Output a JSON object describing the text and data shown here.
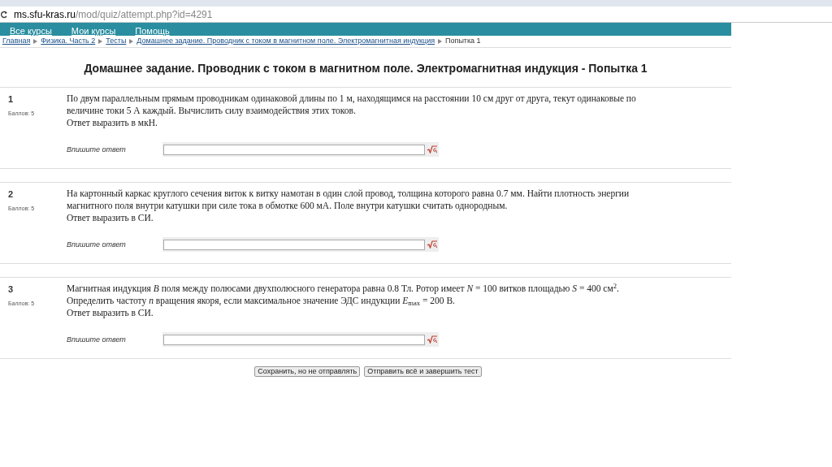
{
  "browser": {
    "url_host": "ms.sfu-kras.ru",
    "url_path": "/mod/quiz/attempt.php?id=4291"
  },
  "nav": [
    "Все курсы",
    "Мои курсы",
    "Помощь"
  ],
  "breadcrumb": [
    {
      "label": "Главная",
      "link": true
    },
    {
      "label": "Физика. Часть 2",
      "link": true
    },
    {
      "label": "Тесты",
      "link": true
    },
    {
      "label": "Домашнее задание. Проводник с током в магнитном поле. Электромагнитная индукция",
      "link": true
    },
    {
      "label": "Попытка 1",
      "link": false
    }
  ],
  "title": "Домашнее задание. Проводник с током в магнитном поле. Электромагнитная индукция - Попытка 1",
  "questions": [
    {
      "number": "1",
      "grade": "Баллов: 5",
      "text": "По двум параллельным прямым проводникам одинаковой длины по 1 м, находящимся на расстоянии 10 см друг от друга, текут одинаковые по величине токи 5 А каждый. Вычислить силу взаимодействия этих токов.",
      "note": "Ответ выразить в мкН.",
      "answer_label": "Впишите ответ"
    },
    {
      "number": "2",
      "grade": "Баллов: 5",
      "text": "На картонный каркас круглого сечения виток к витку намотан в один слой провод, толщина которого равна 0.7 мм. Найти плотность энергии магнитного поля внутри катушки при силе тока в обмотке 600 мА. Поле внутри катушки считать однородным.",
      "note": "Ответ выразить в СИ.",
      "answer_label": "Впишите ответ"
    },
    {
      "number": "3",
      "grade": "Баллов: 5",
      "text": "Магнитная индукция *B* поля между полюсами двухполюсного генератора равна 0.8 Тл. Ротор имеет *N* = 100 витков площадью *S* = 400 см$^{2}$. Определить частоту *n* вращения якоря, если максимальное значение ЭДС индукции *E*$_{max}$ = 200 В.",
      "note": "Ответ выразить в СИ.",
      "answer_label": "Впишите ответ"
    }
  ],
  "buttons": [
    "Сохранить, но не отправлять",
    "Отправить всё и завершить тест"
  ]
}
